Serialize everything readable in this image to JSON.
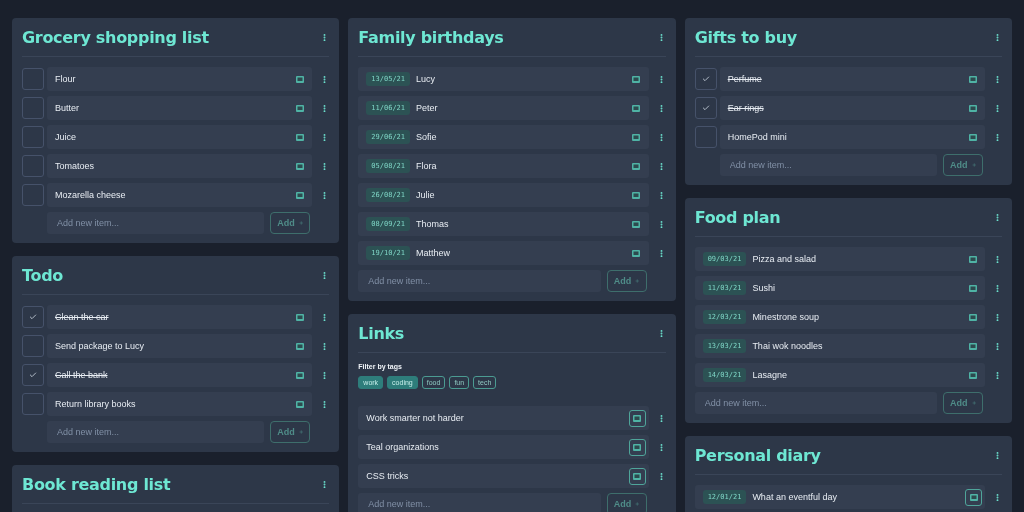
{
  "columns": [
    {
      "cards": [
        {
          "title": "Grocery shopping list",
          "kind": "checklist",
          "items": [
            {
              "kind": "check",
              "text": "Flour",
              "checked": false
            },
            {
              "kind": "check",
              "text": "Butter",
              "checked": false
            },
            {
              "kind": "check",
              "text": "Juice",
              "checked": false
            },
            {
              "kind": "check",
              "text": "Tomatoes",
              "checked": false
            },
            {
              "kind": "check",
              "text": "Mozarella cheese",
              "checked": false
            }
          ],
          "add": {
            "placeholder": "Add new item...",
            "button": "Add"
          }
        },
        {
          "title": "Todo",
          "kind": "checklist",
          "items": [
            {
              "kind": "check",
              "text": "Clean the car",
              "checked": true
            },
            {
              "kind": "check",
              "text": "Send package to Lucy",
              "checked": false
            },
            {
              "kind": "check",
              "text": "Call the bank",
              "checked": true
            },
            {
              "kind": "check",
              "text": "Return library books",
              "checked": false
            }
          ],
          "add": {
            "placeholder": "Add new item...",
            "button": "Add"
          }
        },
        {
          "title": "Book reading list",
          "kind": "checklist"
        }
      ]
    },
    {
      "cards": [
        {
          "title": "Family birthdays",
          "kind": "dated",
          "items": [
            {
              "kind": "date",
              "date": "13/05/21",
              "text": "Lucy"
            },
            {
              "kind": "date",
              "date": "11/06/21",
              "text": "Peter"
            },
            {
              "kind": "date",
              "date": "29/06/21",
              "text": "Sofie"
            },
            {
              "kind": "date",
              "date": "05/08/21",
              "text": "Flora"
            },
            {
              "kind": "date",
              "date": "26/08/21",
              "text": "Julie"
            },
            {
              "kind": "date",
              "date": "08/09/21",
              "text": "Thomas"
            },
            {
              "kind": "date",
              "date": "19/10/21",
              "text": "Matthew"
            }
          ],
          "add": {
            "placeholder": "Add new item...",
            "button": "Add"
          }
        },
        {
          "title": "Links",
          "kind": "links",
          "filter": {
            "label": "Filter by tags",
            "tags": [
              {
                "label": "work",
                "selected": true
              },
              {
                "label": "coding",
                "selected": true
              },
              {
                "label": "food",
                "selected": false
              },
              {
                "label": "fun",
                "selected": false
              },
              {
                "label": "tech",
                "selected": false
              }
            ]
          },
          "items": [
            {
              "kind": "link",
              "text": "Work smarter not harder"
            },
            {
              "kind": "link",
              "text": "Teal organizations"
            },
            {
              "kind": "link",
              "text": "CSS tricks"
            }
          ],
          "add": {
            "placeholder": "Add new item...",
            "button": "Add"
          }
        }
      ]
    },
    {
      "cards": [
        {
          "title": "Gifts to buy",
          "kind": "checklist",
          "items": [
            {
              "kind": "check",
              "text": "Perfume",
              "checked": true
            },
            {
              "kind": "check",
              "text": "Ear rings",
              "checked": true
            },
            {
              "kind": "check",
              "text": "HomePod mini",
              "checked": false
            }
          ],
          "add": {
            "placeholder": "Add new item...",
            "button": "Add"
          }
        },
        {
          "title": "Food plan",
          "kind": "dated",
          "items": [
            {
              "kind": "date",
              "date": "09/03/21",
              "text": "Pizza and salad"
            },
            {
              "kind": "date",
              "date": "11/03/21",
              "text": "Sushi"
            },
            {
              "kind": "date",
              "date": "12/03/21",
              "text": "Minestrone soup"
            },
            {
              "kind": "date",
              "date": "13/03/21",
              "text": "Thai wok noodles"
            },
            {
              "kind": "date",
              "date": "14/03/21",
              "text": "Lasagne"
            }
          ],
          "add": {
            "placeholder": "Add new item...",
            "button": "Add"
          }
        },
        {
          "title": "Personal diary",
          "kind": "dated",
          "items": [
            {
              "kind": "entry",
              "date": "12/01/21",
              "text": "What an eventful day"
            }
          ]
        }
      ]
    }
  ]
}
